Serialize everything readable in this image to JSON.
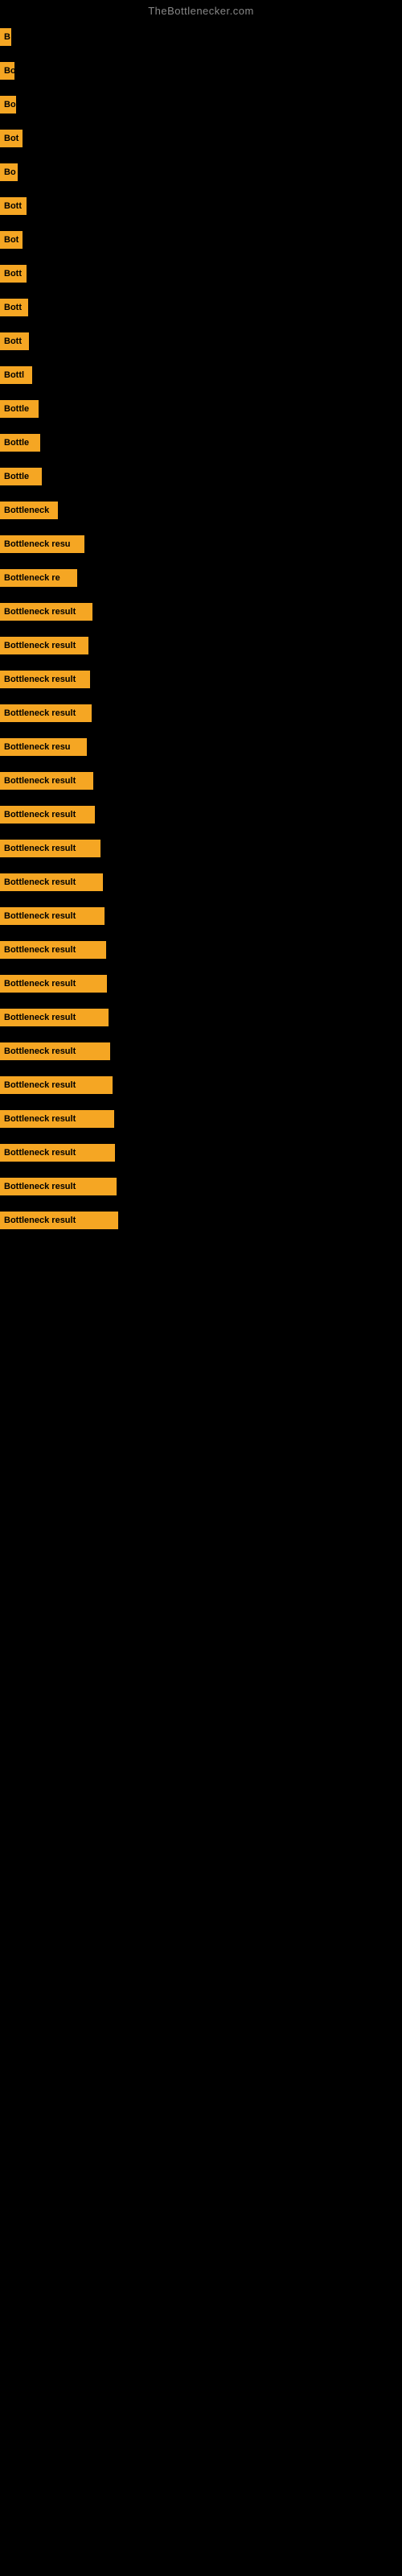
{
  "header": {
    "title": "TheBottlenecker.com"
  },
  "bars": [
    {
      "label": "B",
      "width": 14
    },
    {
      "label": "Bo",
      "width": 18
    },
    {
      "label": "Bo",
      "width": 20
    },
    {
      "label": "Bot",
      "width": 28
    },
    {
      "label": "Bo",
      "width": 22
    },
    {
      "label": "Bott",
      "width": 33
    },
    {
      "label": "Bot",
      "width": 28
    },
    {
      "label": "Bott",
      "width": 33
    },
    {
      "label": "Bott",
      "width": 35
    },
    {
      "label": "Bott",
      "width": 36
    },
    {
      "label": "Bottl",
      "width": 40
    },
    {
      "label": "Bottle",
      "width": 48
    },
    {
      "label": "Bottle",
      "width": 50
    },
    {
      "label": "Bottle",
      "width": 52
    },
    {
      "label": "Bottleneck",
      "width": 72
    },
    {
      "label": "Bottleneck resu",
      "width": 105
    },
    {
      "label": "Bottleneck re",
      "width": 96
    },
    {
      "label": "Bottleneck result",
      "width": 115
    },
    {
      "label": "Bottleneck result",
      "width": 110
    },
    {
      "label": "Bottleneck result",
      "width": 112
    },
    {
      "label": "Bottleneck result",
      "width": 114
    },
    {
      "label": "Bottleneck resu",
      "width": 108
    },
    {
      "label": "Bottleneck result",
      "width": 116
    },
    {
      "label": "Bottleneck result",
      "width": 118
    },
    {
      "label": "Bottleneck result",
      "width": 125
    },
    {
      "label": "Bottleneck result",
      "width": 128
    },
    {
      "label": "Bottleneck result",
      "width": 130
    },
    {
      "label": "Bottleneck result",
      "width": 132
    },
    {
      "label": "Bottleneck result",
      "width": 133
    },
    {
      "label": "Bottleneck result",
      "width": 135
    },
    {
      "label": "Bottleneck result",
      "width": 137
    },
    {
      "label": "Bottleneck result",
      "width": 140
    },
    {
      "label": "Bottleneck result",
      "width": 142
    },
    {
      "label": "Bottleneck result",
      "width": 143
    },
    {
      "label": "Bottleneck result",
      "width": 145
    },
    {
      "label": "Bottleneck result",
      "width": 147
    }
  ]
}
